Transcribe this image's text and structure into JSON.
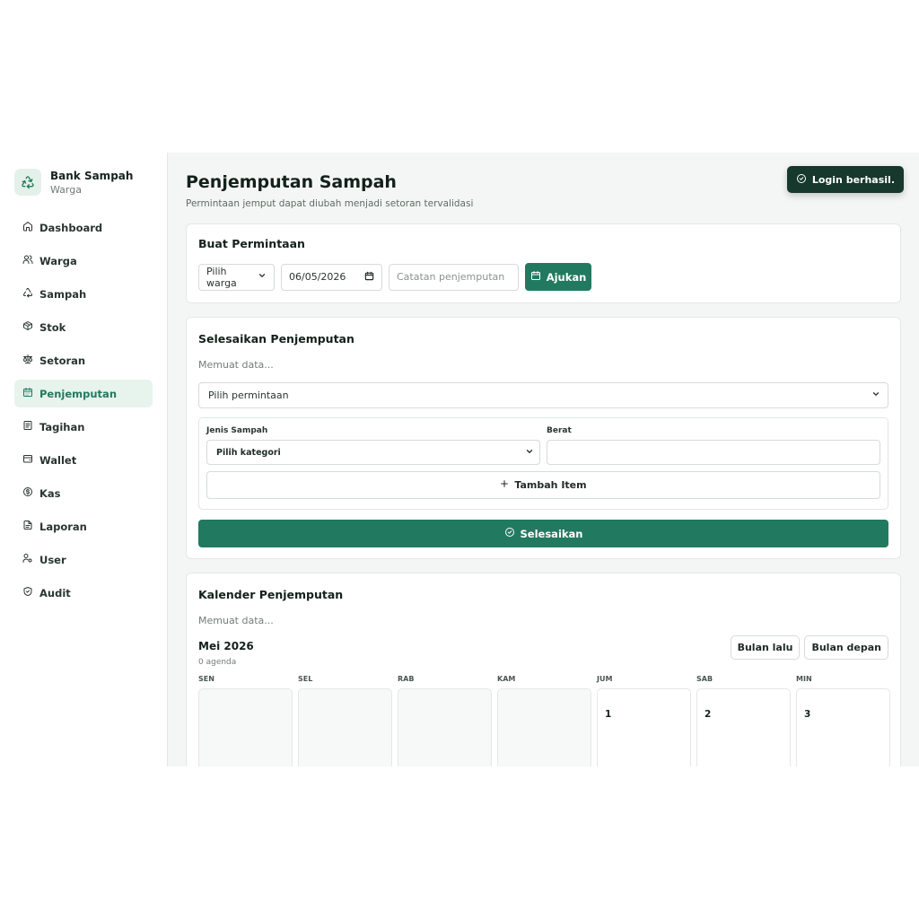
{
  "brand": {
    "title": "Bank Sampah",
    "subtitle": "Warga",
    "icon": "recycle-icon"
  },
  "sidebar": {
    "items": [
      {
        "label": "Dashboard",
        "icon": "home-icon"
      },
      {
        "label": "Warga",
        "icon": "users-icon"
      },
      {
        "label": "Sampah",
        "icon": "recycle-icon"
      },
      {
        "label": "Stok",
        "icon": "package-icon"
      },
      {
        "label": "Setoran",
        "icon": "scale-icon"
      },
      {
        "label": "Penjemputan",
        "icon": "calendar-icon",
        "active": true
      },
      {
        "label": "Tagihan",
        "icon": "receipt-icon"
      },
      {
        "label": "Wallet",
        "icon": "wallet-icon"
      },
      {
        "label": "Kas",
        "icon": "dollar-circle-icon"
      },
      {
        "label": "Laporan",
        "icon": "file-icon"
      },
      {
        "label": "User",
        "icon": "user-key-icon"
      },
      {
        "label": "Audit",
        "icon": "shield-check-icon"
      }
    ]
  },
  "header": {
    "title": "Penjemputan Sampah",
    "subtitle": "Permintaan jemput dapat diubah menjadi setoran tervalidasi"
  },
  "toast": {
    "text": "Login berhasil."
  },
  "request": {
    "title": "Buat Permintaan",
    "warga_select": "Pilih warga",
    "date_value": "06/05/2026",
    "note_placeholder": "Catatan penjemputan",
    "submit_label": "Ajukan"
  },
  "complete": {
    "title": "Selesaikan Penjemputan",
    "loading": "Memuat data...",
    "request_select": "Pilih permintaan",
    "col_type": "Jenis Sampah",
    "col_weight": "Berat",
    "category_select": "Pilih kategori",
    "add_item_label": "Tambah Item",
    "finish_label": "Selesaikan"
  },
  "calendar": {
    "title": "Kalender Penjemputan",
    "loading": "Memuat data...",
    "month": "Mei 2026",
    "agenda": "0 agenda",
    "prev_label": "Bulan lalu",
    "next_label": "Bulan depan",
    "weekdays": [
      "SEN",
      "SEL",
      "RAB",
      "KAM",
      "JUM",
      "SAB",
      "MIN"
    ],
    "days": [
      "",
      "",
      "",
      "",
      "1",
      "2",
      "3"
    ]
  },
  "colors": {
    "accent": "#217a5f",
    "toast_bg": "#17382c",
    "active_bg": "#e7f3ed"
  }
}
